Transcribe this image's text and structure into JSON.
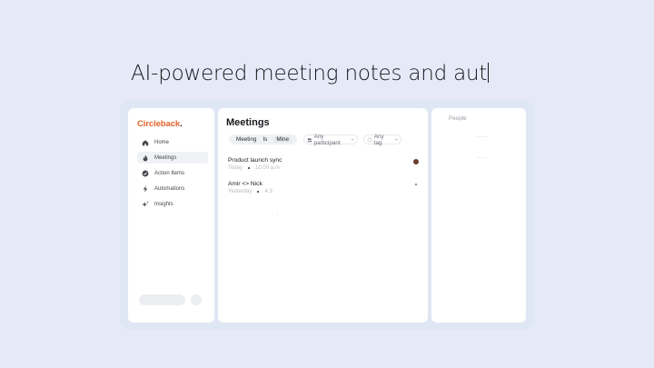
{
  "headline": "AI-powered meeting notes and aut",
  "app": {
    "brand": "Circleback",
    "brand_dot": "."
  },
  "sidebar": {
    "items": [
      {
        "label": "Home",
        "icon": "home-icon"
      },
      {
        "label": "Meetings",
        "icon": "flame-icon",
        "active": true
      },
      {
        "label": "Action Items",
        "icon": "check-circle-icon"
      },
      {
        "label": "Automations",
        "icon": "bolt-icon"
      },
      {
        "label": "Insights",
        "icon": "sparkle-icon"
      }
    ]
  },
  "main": {
    "title": "Meetings",
    "filters": {
      "meeting": "Meeting",
      "is": "Is",
      "mine": "Mine",
      "participant": "Any participant",
      "tag": "Any tag"
    },
    "meetings": [
      {
        "title": "Product launch sync",
        "date": "Today",
        "time": "10:00 a.m"
      },
      {
        "title": "Amir <> Nick",
        "date": "Yesterday",
        "time": "4:3"
      }
    ]
  },
  "people": {
    "title": "People"
  },
  "colors": {
    "brand": "#e2622b",
    "background": "#e6eaf8"
  }
}
